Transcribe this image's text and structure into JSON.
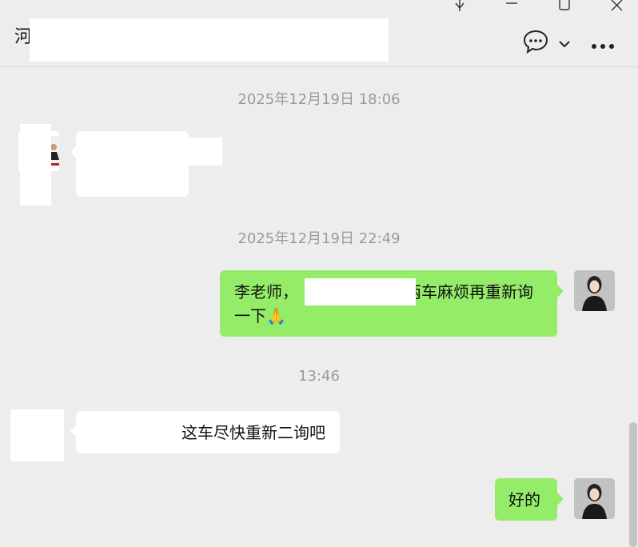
{
  "window": {
    "title_visible": "河",
    "icons": [
      "pin-icon",
      "minimize-icon",
      "maximize-icon",
      "close-icon",
      "chat-bubble-icon",
      "chevron-down-icon",
      "more-icon"
    ]
  },
  "messages": {
    "time1": "2025年12月19日 18:06",
    "time2": "2025年12月19日 22:49",
    "time3": "13:46",
    "out1_line1_a": "李老师，",
    "out1_line1_b": "两车麻烦再重新询",
    "out1_line2": "一下",
    "out1_emoji": "🙏",
    "in2_text": "这车尽快重新二询吧",
    "out2_text": "好的"
  },
  "colors": {
    "background": "#ededed",
    "outgoing_bubble": "#95ec69",
    "incoming_bubble": "#ffffff",
    "timestamp": "#9a9a9a"
  }
}
